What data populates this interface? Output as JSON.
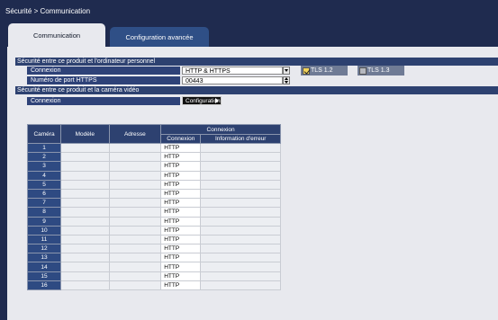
{
  "title": "Sécurité > Communication",
  "tabs": [
    {
      "label": "Communication",
      "active": true
    },
    {
      "label": "Configuration avancée",
      "active": false
    }
  ],
  "section_pc": {
    "header": "Sécurité entre ce produit et l'ordinateur personnel",
    "connection_label": "Connexion",
    "connection_value": "HTTP & HTTPS",
    "tls12_label": "TLS 1.2",
    "tls12_checked": true,
    "tls13_label": "TLS 1.3",
    "tls13_checked": false,
    "https_port_label": "Numéro de port HTTPS",
    "https_port_value": "00443"
  },
  "section_camera": {
    "header": "Sécurité entre ce produit et la caméra vidéo",
    "connection_label": "Connexion",
    "config_button": "Configuration"
  },
  "table": {
    "col_camera": "Caméra",
    "col_model": "Modèle",
    "col_address": "Adresse",
    "col_connection_group": "Connexion",
    "col_connection": "Connexion",
    "col_error": "Information d'erreur",
    "rows": [
      {
        "num": "1",
        "model": "",
        "address": "",
        "connection": "HTTP",
        "error": ""
      },
      {
        "num": "2",
        "model": "",
        "address": "",
        "connection": "HTTP",
        "error": ""
      },
      {
        "num": "3",
        "model": "",
        "address": "",
        "connection": "HTTP",
        "error": ""
      },
      {
        "num": "4",
        "model": "",
        "address": "",
        "connection": "HTTP",
        "error": ""
      },
      {
        "num": "5",
        "model": "",
        "address": "",
        "connection": "HTTP",
        "error": ""
      },
      {
        "num": "6",
        "model": "",
        "address": "",
        "connection": "HTTP",
        "error": ""
      },
      {
        "num": "7",
        "model": "",
        "address": "",
        "connection": "HTTP",
        "error": ""
      },
      {
        "num": "8",
        "model": "",
        "address": "",
        "connection": "HTTP",
        "error": ""
      },
      {
        "num": "9",
        "model": "",
        "address": "",
        "connection": "HTTP",
        "error": ""
      },
      {
        "num": "10",
        "model": "",
        "address": "",
        "connection": "HTTP",
        "error": ""
      },
      {
        "num": "11",
        "model": "",
        "address": "",
        "connection": "HTTP",
        "error": ""
      },
      {
        "num": "12",
        "model": "",
        "address": "",
        "connection": "HTTP",
        "error": ""
      },
      {
        "num": "13",
        "model": "",
        "address": "",
        "connection": "HTTP",
        "error": ""
      },
      {
        "num": "14",
        "model": "",
        "address": "",
        "connection": "HTTP",
        "error": ""
      },
      {
        "num": "15",
        "model": "",
        "address": "",
        "connection": "HTTP",
        "error": ""
      },
      {
        "num": "16",
        "model": "",
        "address": "",
        "connection": "HTTP",
        "error": ""
      }
    ]
  },
  "colors": {
    "background": "#1f2b4f",
    "panel": "#e8e9ee",
    "header": "#2d4170",
    "tab_inactive": "#2f4f86"
  }
}
